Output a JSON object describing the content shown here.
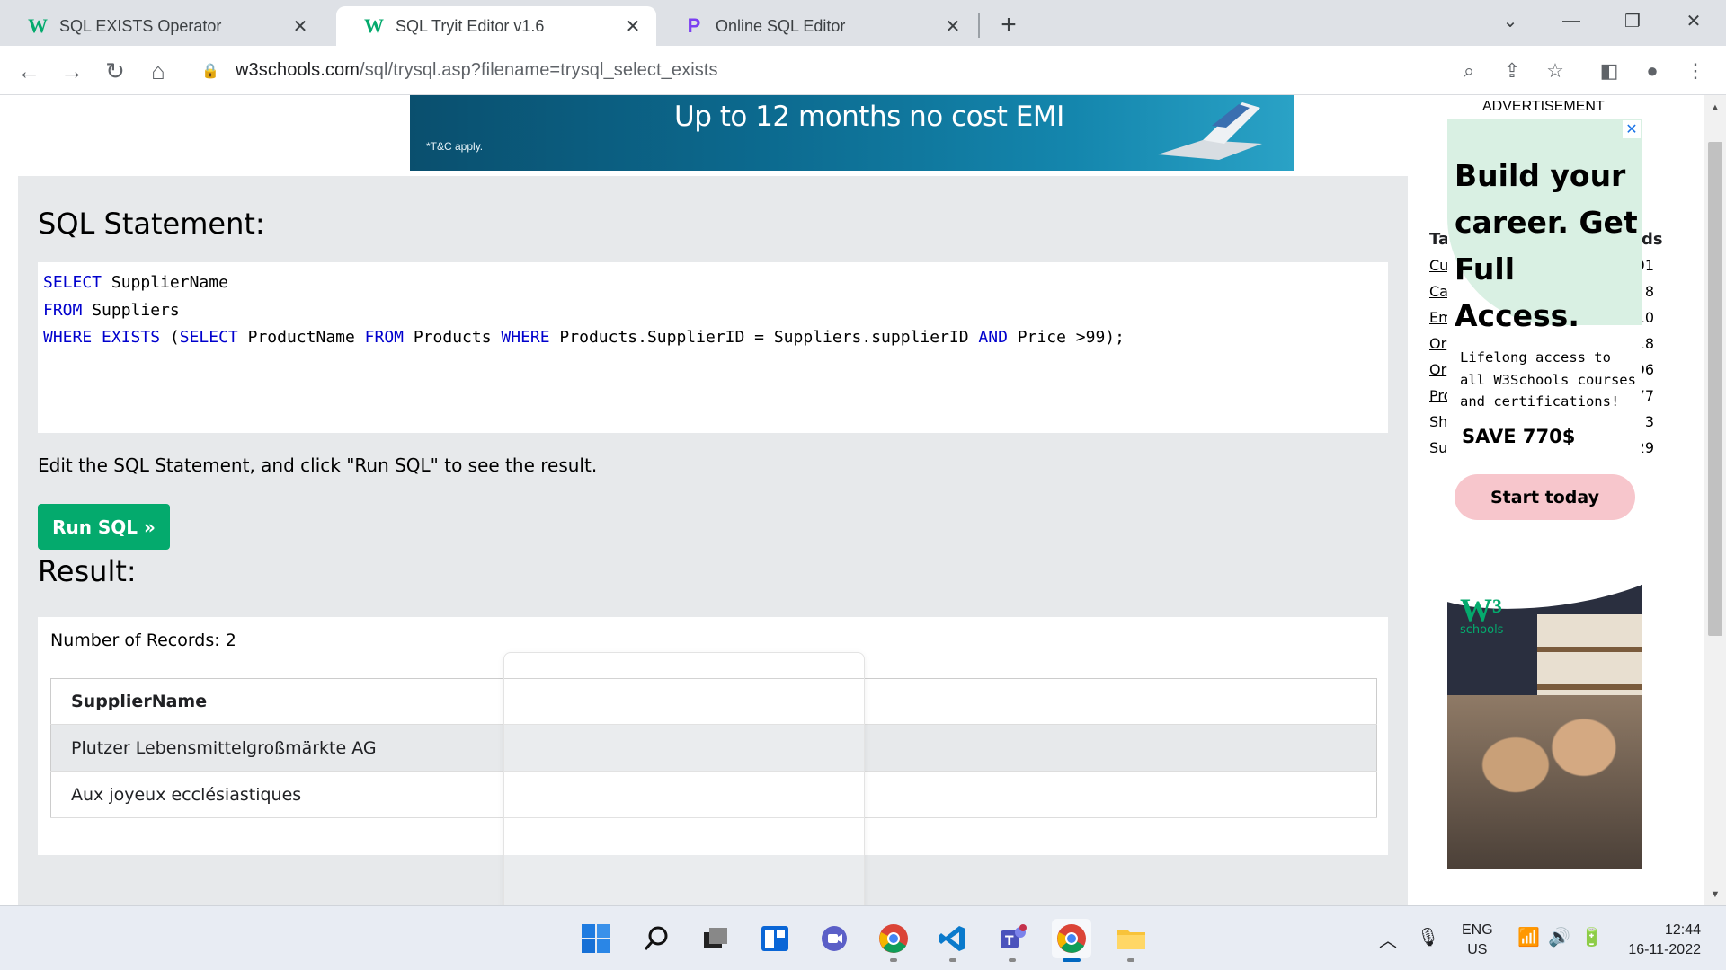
{
  "browser": {
    "tabs": [
      {
        "title": "SQL EXISTS Operator",
        "favicon": "w3schools-icon"
      },
      {
        "title": "SQL Tryit Editor v1.6",
        "favicon": "w3schools-icon"
      },
      {
        "title": "Online SQL Editor",
        "favicon": "programiz-icon"
      }
    ],
    "url_host": "w3schools.com",
    "url_path": "/sql/trysql.asp?filename=trysql_select_exists"
  },
  "banner": {
    "headline": "Up to 12 months no cost EMI",
    "terms": "*T&C apply."
  },
  "editor": {
    "sql_heading": "SQL Statement:",
    "sql_lines": [
      [
        {
          "t": "SELECT",
          "kw": true
        },
        {
          "t": " SupplierName",
          "kw": false
        }
      ],
      [
        {
          "t": "FROM",
          "kw": true
        },
        {
          "t": " Suppliers",
          "kw": false
        }
      ],
      [
        {
          "t": "WHERE",
          "kw": true
        },
        {
          "t": " ",
          "kw": false
        },
        {
          "t": "EXISTS",
          "kw": true
        },
        {
          "t": " (",
          "kw": false
        },
        {
          "t": "SELECT",
          "kw": true
        },
        {
          "t": " ProductName ",
          "kw": false
        },
        {
          "t": "FROM",
          "kw": true
        },
        {
          "t": " Products ",
          "kw": false
        },
        {
          "t": "WHERE",
          "kw": true
        },
        {
          "t": " Products.SupplierID = Suppliers.supplierID ",
          "kw": false
        },
        {
          "t": "AND",
          "kw": true
        },
        {
          "t": " Price >99);",
          "kw": false
        }
      ]
    ],
    "hint": "Edit the SQL Statement, and click \"Run SQL\" to see the result.",
    "run_label": "Run SQL »",
    "result_heading": "Result:",
    "records_text": "Number of Records: 2",
    "column": "SupplierName",
    "rows": [
      "Plutzer Lebensmittelgroßmärkte AG",
      "Aux joyeux ecclésiastiques"
    ]
  },
  "sidebar": {
    "ad_label": "ADVERTISEMENT",
    "table_header_left": "Ta",
    "table_header_right": "ds",
    "tables": [
      {
        "name": "Cu",
        "count": "91"
      },
      {
        "name": "Ca",
        "count": "8"
      },
      {
        "name": "Em",
        "count": "10"
      },
      {
        "name": "Or",
        "count": "18"
      },
      {
        "name": "Or",
        "count": "96"
      },
      {
        "name": "Pro",
        "count": "77"
      },
      {
        "name": "Sh",
        "count": "3"
      },
      {
        "name": "Su",
        "count": "29"
      }
    ]
  },
  "ad": {
    "headline": "Build your career. Get Full Access.",
    "sub": "Lifelong access to all W3Schools courses and certifications!",
    "save": "SAVE 770$",
    "cta": "Start today",
    "logo_sub": "schools"
  },
  "taskbar": {
    "lang_top": "ENG",
    "lang_bottom": "US",
    "time": "12:44",
    "date": "16-11-2022",
    "apps": [
      "windows-start-icon",
      "search-icon",
      "task-view-icon",
      "widgets-icon",
      "teams-chat-icon",
      "chrome-icon",
      "vscode-icon",
      "teams-icon",
      "chrome-active-icon",
      "file-explorer-icon"
    ]
  },
  "colors": {
    "accent_green": "#04aa6d",
    "sql_keyword": "#0000cd",
    "panel_bg": "#e7e9eb"
  }
}
